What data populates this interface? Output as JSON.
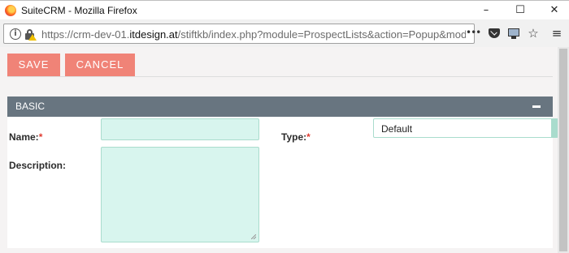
{
  "window": {
    "title": "SuiteCRM - Mozilla Firefox",
    "controls": {
      "minimize": "–",
      "maximize": "☐",
      "close": "✕"
    }
  },
  "browser": {
    "url_prefix": "https://crm-dev-01.",
    "url_domain": "itdesign.at",
    "url_suffix": "/stiftkb/index.php?module=ProspectLists&action=Popup&mode=",
    "icons": [
      "info-icon",
      "lock-warning-icon",
      "more-icon",
      "pocket-icon",
      "monitor-icon",
      "bookmark-star-icon",
      "hamburger-menu-icon"
    ],
    "more_glyph": "•••",
    "star_glyph": "☆",
    "menu_glyph": "≡"
  },
  "toolbar": {
    "save_label": "SAVE",
    "cancel_label": "CANCEL"
  },
  "panel": {
    "title": "BASIC",
    "collapse_glyph": "–",
    "fields": {
      "name": {
        "label": "Name:",
        "required_mark": "*",
        "value": ""
      },
      "type": {
        "label": "Type:",
        "required_mark": "*",
        "value": "Default"
      },
      "description": {
        "label": "Description:",
        "value": ""
      }
    }
  },
  "colors": {
    "button_bg": "#f08377",
    "panel_header_bg": "#687580",
    "input_bg": "#d8f5ee",
    "input_border": "#a9dccd",
    "required": "#e03c31"
  }
}
